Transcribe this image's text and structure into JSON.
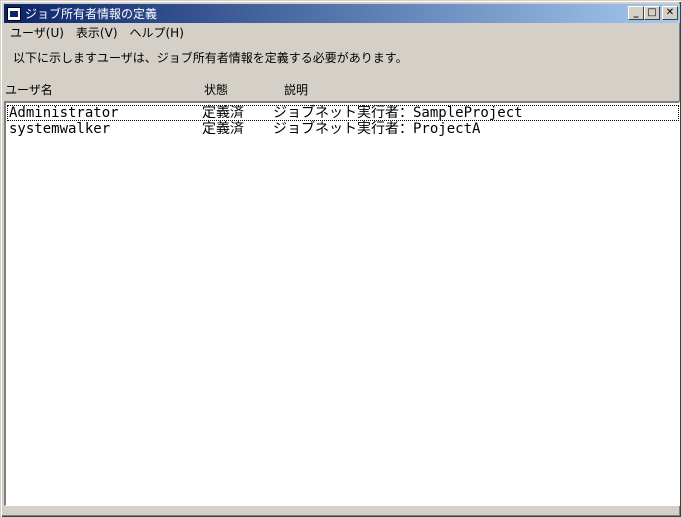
{
  "window": {
    "title": "ジョブ所有者情報の定義",
    "buttons": {
      "minimize": "_",
      "maximize": "□",
      "close": "✕"
    }
  },
  "menu": [
    {
      "label": "ユーザ(U)"
    },
    {
      "label": "表示(V)"
    },
    {
      "label": "ヘルプ(H)"
    }
  ],
  "message": "以下に示しますユーザは、ジョブ所有者情報を定義する必要があります。",
  "columns": {
    "user": "ユーザ名",
    "status": "状態",
    "description": "説明"
  },
  "rows": [
    {
      "user": "Administrator",
      "status": "定義済",
      "description": "ジョブネット実行者：SampleProject"
    },
    {
      "user": "systemwalker",
      "status": "定義済",
      "description": "ジョブネット実行者：ProjectA"
    }
  ]
}
